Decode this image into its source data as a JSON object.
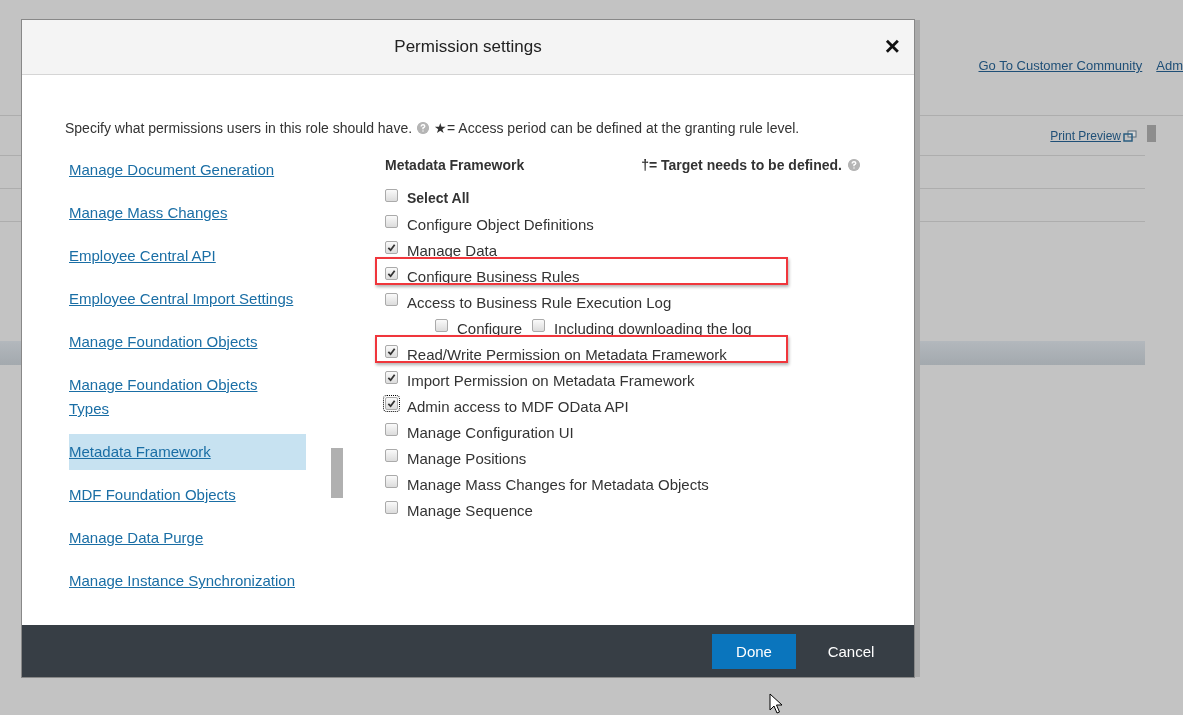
{
  "page": {
    "header_links": [
      "Go To Customer Community",
      "Adm"
    ],
    "print_link": "Print Preview"
  },
  "dialog": {
    "title": "Permission settings",
    "close": "×",
    "intro": "Specify what permissions users in this role should have.",
    "intro_note": "★= Access period can be defined at the granting rule level.",
    "categories": [
      {
        "label": "Manage Document Generation",
        "selected": false
      },
      {
        "label": "Manage Mass Changes",
        "selected": false
      },
      {
        "label": "Employee Central API",
        "selected": false
      },
      {
        "label": "Employee Central Import Settings",
        "selected": false
      },
      {
        "label": "Manage Foundation Objects",
        "selected": false
      },
      {
        "label": "Manage Foundation Objects Types",
        "selected": false
      },
      {
        "label": "Metadata Framework",
        "selected": true
      },
      {
        "label": "MDF Foundation Objects",
        "selected": false
      },
      {
        "label": "Manage Data Purge",
        "selected": false
      },
      {
        "label": "Manage Instance Synchronization",
        "selected": false
      }
    ],
    "section_title": "Metadata Framework",
    "target_note": "†= Target needs to be defined.",
    "permissions": [
      {
        "kind": "select_all",
        "label": "Select All",
        "checked": false,
        "highlighted": false,
        "focused": false
      },
      {
        "kind": "item",
        "label": "Configure Object Definitions",
        "checked": false,
        "highlighted": false,
        "focused": false
      },
      {
        "kind": "item",
        "label": "Manage Data",
        "checked": true,
        "highlighted": false,
        "focused": false
      },
      {
        "kind": "item",
        "label": "Configure Business Rules",
        "checked": true,
        "highlighted": true,
        "focused": false
      },
      {
        "kind": "item",
        "label": "Access to Business Rule Execution Log",
        "checked": false,
        "highlighted": false,
        "focused": false,
        "children": [
          {
            "label": "Configure",
            "checked": false
          },
          {
            "label": "Including downloading the log",
            "checked": false
          }
        ]
      },
      {
        "kind": "item",
        "label": "Read/Write Permission on Metadata Framework",
        "checked": true,
        "highlighted": true,
        "focused": false
      },
      {
        "kind": "item",
        "label": "Import Permission on Metadata Framework",
        "checked": true,
        "highlighted": false,
        "focused": false
      },
      {
        "kind": "item",
        "label": "Admin access to MDF OData API",
        "checked": true,
        "highlighted": false,
        "focused": true
      },
      {
        "kind": "item",
        "label": "Manage Configuration UI",
        "checked": false,
        "highlighted": false,
        "focused": false
      },
      {
        "kind": "item",
        "label": "Manage Positions",
        "checked": false,
        "highlighted": false,
        "focused": false
      },
      {
        "kind": "item",
        "label": "Manage Mass Changes for Metadata Objects",
        "checked": false,
        "highlighted": false,
        "focused": false
      },
      {
        "kind": "item",
        "label": "Manage Sequence",
        "checked": false,
        "highlighted": false,
        "focused": false
      }
    ],
    "buttons": [
      {
        "label": "Done",
        "kind": "primary"
      },
      {
        "label": "Cancel",
        "kind": "secondary"
      }
    ]
  }
}
